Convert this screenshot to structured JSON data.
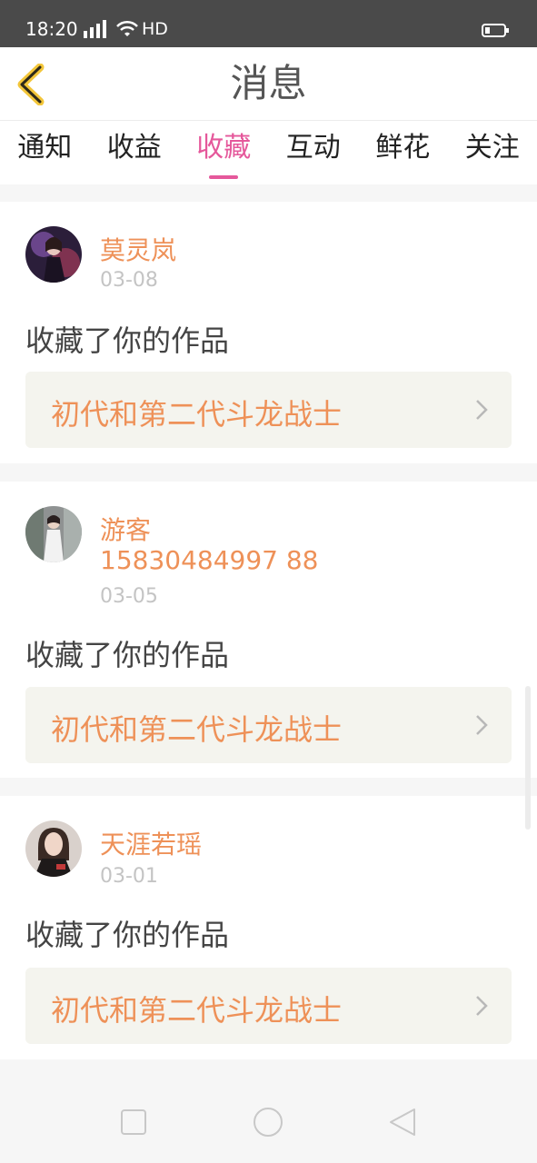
{
  "status_bar": {
    "time": "18:20",
    "network": "4G",
    "hd": "HD"
  },
  "header": {
    "title": "消息"
  },
  "tabs": [
    {
      "label": "通知"
    },
    {
      "label": "收益"
    },
    {
      "label": "收藏",
      "active": true
    },
    {
      "label": "互动"
    },
    {
      "label": "鲜花"
    },
    {
      "label": "关注"
    }
  ],
  "items": [
    {
      "name": "莫灵岚",
      "date": "03-08",
      "action": "收藏了你的作品",
      "work": "初代和第二代斗龙战士"
    },
    {
      "name": "游客",
      "phone": "15830484997 88",
      "date": "03-05",
      "action": "收藏了你的作品",
      "work": "初代和第二代斗龙战士"
    },
    {
      "name": "天涯若瑶",
      "date": "03-01",
      "action": "收藏了你的作品",
      "work": "初代和第二代斗龙战士"
    }
  ],
  "colors": {
    "accent": "#e5589b",
    "name": "#ee9158",
    "back_icon": "#f3c63a"
  }
}
